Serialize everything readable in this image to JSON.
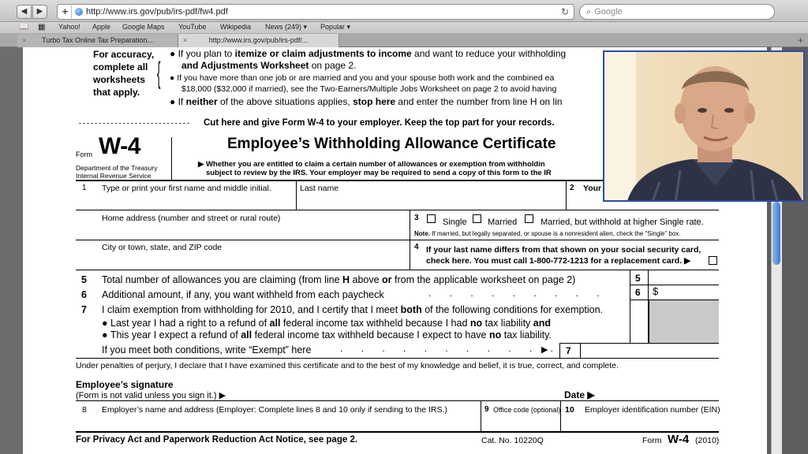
{
  "browser": {
    "url": "http://www.irs.gov/pub/irs-pdf/fw4.pdf",
    "search_placeholder": "Google",
    "bookmarks": [
      "Yahoo!",
      "Apple",
      "Google Maps",
      "YouTube",
      "Wikipedia",
      "News (249) ▾",
      "Popular ▾"
    ],
    "tabs": [
      "Turbo Tax Online Tax Preparation...",
      "http://www.irs.gov/pub/irs-pdf/..."
    ]
  },
  "worksheet": {
    "label_lines": [
      "For accuracy,",
      "complete all",
      "worksheets",
      "that apply."
    ],
    "b1a_pre": "If you plan to ",
    "b1a_bold": "itemize or claim adjustments to income",
    "b1a_post": " and want to reduce your withholding",
    "b1b_bold": "and Adjustments Worksheet",
    "b1b_post": " on page 2.",
    "b2a": "If you have more than one job or are married and you and your spouse both work and the combined ea",
    "b2b": "$18,000 ($32,000 if married), see the Two-Earners/Multiple Jobs Worksheet on page 2 to avoid having",
    "b3_pre": "If ",
    "b3_bold1": "neither",
    "b3_mid": " of the above situations applies, ",
    "b3_bold2": "stop here",
    "b3_post": " and enter the number from line H on lin"
  },
  "cut_line": "Cut here and give Form W-4 to your employer. Keep the top part for your records.",
  "form": {
    "form_word": "Form",
    "number": "W-4",
    "dept": "Department of the Treasury",
    "irs": "Internal Revenue Service",
    "title": "Employee’s Withholding Allowance Certificate",
    "warn1": "Whether you are entitled to claim a certain number of allowances or exemption from withholdin",
    "warn2": "subject to review by the IRS. Your employer may be required to send a copy of this form to the IR",
    "line1_num": "1",
    "line1_label": "Type or print your first name and middle initial.",
    "last_name": "Last name",
    "line2_num": "2",
    "line2_label": "Your",
    "home_address": "Home address (number and street or rural route)",
    "line3_num": "3",
    "single": "Single",
    "married": "Married",
    "married_higher": "Married, but withhold at higher Single rate.",
    "note3_bold": "Note.",
    "note3": " If married, but legally separated, or spouse is a nonresident alien, check the “Single” box.",
    "city": "City or town, state, and ZIP code",
    "line4_num": "4",
    "line4a": "If your last name differs from that shown on your social security card,",
    "line4b": "check here. You must call 1-800-772-1213 for a replacement card. ▶",
    "line5_num": "5",
    "line5_pre": "Total number of allowances you are claiming (from line ",
    "line5_H": "H",
    "line5_mid": " above ",
    "line5_or": "or",
    "line5_post": " from the applicable worksheet on page 2)",
    "box5": "5",
    "line6_num": "6",
    "line6": "Additional amount, if any, you want withheld from each paycheck",
    "box6": "6",
    "dollar": "$",
    "line7_num": "7",
    "line7_pre": "I claim exemption from withholding for 2010, and I certify that I meet ",
    "line7_both": "both",
    "line7_post": " of the following conditions for exemption.",
    "b7a_pre": "Last year I had a right to a refund of ",
    "b7a_all": "all",
    "b7a_mid": " federal income tax withheld because I had ",
    "b7a_no": "no",
    "b7a_post": " tax liability ",
    "b7a_and": "and",
    "b7b_pre": "This year I expect a refund of ",
    "b7b_all": "all",
    "b7b_mid": " federal income tax withheld because I expect to have ",
    "b7b_no": "no",
    "b7b_post": " tax liability.",
    "exempt": "If you meet both conditions, write “Exempt” here",
    "box7": "7",
    "perjury": "Under penalties of perjury, I declare that I have examined this certificate and to the best of my knowledge and belief, it is true, correct, and complete.",
    "sig_label": "Employee’s signature",
    "sig_note": "(Form is not valid unless you sign it.) ▶",
    "date_label": "Date ▶",
    "line8_num": "8",
    "line8": "Employer’s name and address (Employer: Complete lines 8 and 10 only if sending to the IRS.)",
    "line9_num": "9",
    "line9": "Office code (optional)",
    "line10_num": "10",
    "line10": "Employer identification number (EIN)",
    "privacy": "For Privacy Act and Paperwork Reduction Act Notice, see page 2.",
    "cat": "Cat. No. 10220Q",
    "footer_form": "Form",
    "footer_num": "W-4",
    "footer_year": "(2010)"
  },
  "colors": {
    "shade": "#c9c9c9",
    "video_border": "#2f4aa8"
  }
}
